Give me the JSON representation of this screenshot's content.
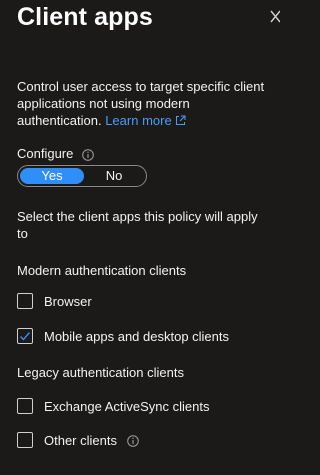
{
  "panel": {
    "title": "Client apps",
    "description": "Control user access to target specific client applications not using modern authentication.",
    "learn_more_label": "Learn more",
    "icons": {
      "close": "close-icon",
      "external_link": "external-link-icon",
      "info": "info-icon"
    }
  },
  "configure": {
    "label": "Configure",
    "options": [
      "Yes",
      "No"
    ],
    "selected": "Yes"
  },
  "select_text": "Select the client apps this policy will apply to",
  "modern_group": {
    "label": "Modern authentication clients",
    "items": [
      {
        "label": "Browser",
        "checked": false
      },
      {
        "label": "Mobile apps and desktop clients",
        "checked": true
      }
    ]
  },
  "legacy_group": {
    "label": "Legacy authentication clients",
    "items": [
      {
        "label": "Exchange ActiveSync clients",
        "checked": false
      },
      {
        "label": "Other clients",
        "checked": false
      }
    ]
  },
  "colors": {
    "background": "#1b1a19",
    "accent": "#2f8ef7",
    "link": "#479ef5",
    "text": "#f3f2f1"
  }
}
